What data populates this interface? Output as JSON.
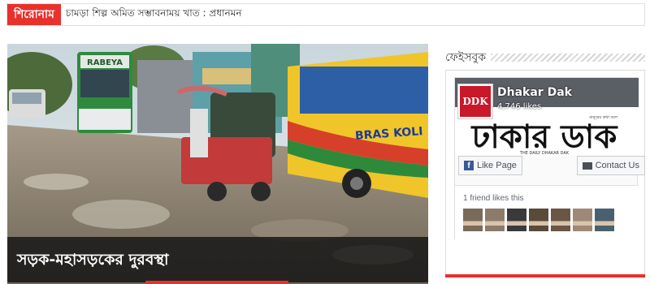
{
  "ticker": {
    "label": "শিরোনাম",
    "text": "চামড়া শিল্প অমিত সম্ভাবনাময় খাত : প্রধানমন"
  },
  "feature": {
    "title": "সড়ক-মহাসড়কের দুরবস্থা",
    "bus_sign": "RABEYA",
    "bus_brand": "BRAS KOLI"
  },
  "sidebar": {
    "heading": "ফেইসবুক",
    "fb": {
      "page_name": "Dhakar Dak",
      "likes": "4,746 likes",
      "profile_text": "DDK",
      "cover_title": "ঢাকার ডাক",
      "cover_tagline": "মানুষের কথা বলে",
      "cover_subtitle": "THE DAILY DHAKAR DAK",
      "like_button": "Like Page",
      "contact_button": "Contact Us",
      "friends_text": "1 friend likes this",
      "avatar_colors": [
        "#7a6a5a",
        "#8c7b6b",
        "#3a3a3a",
        "#5a4a3a",
        "#6b5545",
        "#a08878",
        "#4a6070"
      ]
    }
  },
  "colors": {
    "accent": "#e8312c",
    "fb_blue": "#3b5998"
  }
}
